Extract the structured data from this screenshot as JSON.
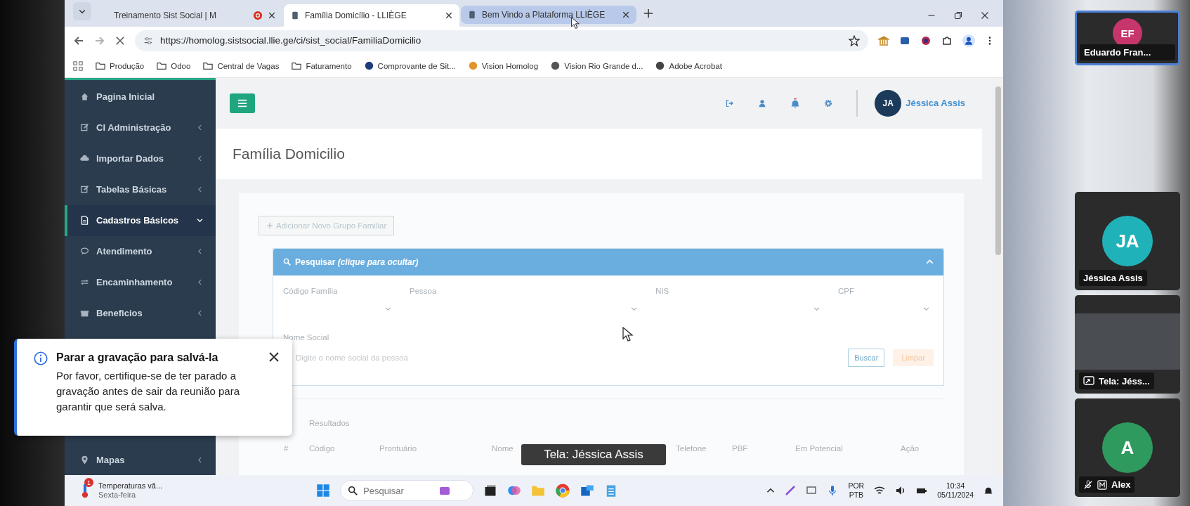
{
  "browser": {
    "tabs": [
      {
        "title": "Treinamento Sist Social | M",
        "recording": true,
        "selected": false
      },
      {
        "title": "Família Domicílio - LLIÈGE",
        "recording": false,
        "selected": true
      },
      {
        "title": "Bem Vindo a Plataforma LLIÈGE",
        "recording": false,
        "selected": false
      }
    ],
    "address": "https://homolog.sistsocial.llie.ge/ci/sist_social/FamiliaDomicilio",
    "bookmarks": [
      {
        "label": "Produção",
        "kind": "folder"
      },
      {
        "label": "Odoo",
        "kind": "folder"
      },
      {
        "label": "Central de Vagas",
        "kind": "folder"
      },
      {
        "label": "Faturamento",
        "kind": "folder"
      },
      {
        "label": "Comprovante de Sit...",
        "kind": "site"
      },
      {
        "label": "Vision Homolog",
        "kind": "site"
      },
      {
        "label": "Vision Rio Grande d...",
        "kind": "site"
      },
      {
        "label": "Adobe Acrobat",
        "kind": "site"
      }
    ]
  },
  "sidebar": {
    "items": [
      {
        "label": "Pagina Inicial",
        "selected": false
      },
      {
        "label": "CI Administração",
        "selected": false
      },
      {
        "label": "Importar Dados",
        "selected": false
      },
      {
        "label": "Tabelas Básicas",
        "selected": false
      },
      {
        "label": "Cadastros Básicos",
        "selected": true
      },
      {
        "label": "Atendimento",
        "selected": false
      },
      {
        "label": "Encaminhamento",
        "selected": false
      },
      {
        "label": "Beneficios",
        "selected": false
      },
      {
        "label": "Mapas",
        "selected": false
      }
    ]
  },
  "header": {
    "avatar": "JA",
    "user": "Jéssica Assis"
  },
  "page": {
    "title": "Família Domicilio",
    "add_button": "Adicionar Novo Grupo Familiar",
    "search_panel": {
      "title": "Pesquisar *(clique para ocultar)*",
      "fields": [
        {
          "label": "Código Família"
        },
        {
          "label": "Pessoa"
        },
        {
          "label": "NIS"
        },
        {
          "label": "CPF"
        }
      ],
      "name_field": {
        "label": "Nome Social",
        "placeholder": "Digite o nome social da pessoa"
      },
      "buttons": [
        "Buscar",
        "Limpar"
      ]
    },
    "results": {
      "title": "Resultados",
      "columns": [
        "#",
        "Código",
        "Prontuário",
        "Nome",
        "Telefone",
        "PBF",
        "Em Potencial",
        "Ação"
      ]
    }
  },
  "taskbar": {
    "weather": {
      "badge": "1",
      "title": "Temperaturas vã...",
      "subtitle": "Sexta-feira"
    },
    "search": {
      "placeholder": "Pesquisar"
    },
    "language": [
      "POR",
      "PTB"
    ],
    "time": "10:34",
    "date": "05/11/2024"
  },
  "notice": {
    "title": "Parar a gravação para salvá-la",
    "body": "Por favor, certifique-se de ter parado a gravação antes de sair da reunião para garantir que será salva."
  },
  "caption": "Tela: Jéssica Assis",
  "participants": [
    {
      "kind": "avatar",
      "initials": "EF",
      "name": "Eduardo Fran...",
      "color": "#c7356d",
      "selected": true,
      "muted": false
    },
    {
      "kind": "avatar",
      "initials": "JA",
      "name": "Jéssica Assis",
      "color": "#1fb3b9",
      "selected": false,
      "muted": false
    },
    {
      "kind": "screen",
      "name": "Tela: Jéss...",
      "selected": false,
      "muted": false
    },
    {
      "kind": "avatar",
      "initials": "A",
      "name": "Alex",
      "color": "#2f9a5e",
      "selected": false,
      "muted": true
    }
  ]
}
